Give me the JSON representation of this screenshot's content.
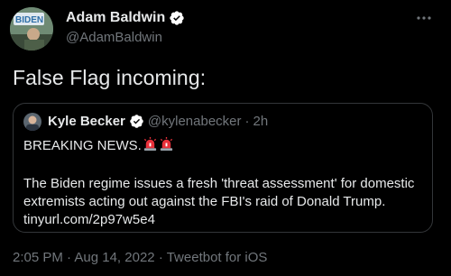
{
  "tweet": {
    "author_name": "Adam Baldwin",
    "author_handle": "@AdamBaldwin",
    "avatar_text": "BIDEN",
    "text": "False Flag incoming:",
    "meta": {
      "time": "2:05 PM",
      "date": "Aug 14, 2022",
      "client": "Tweetbot for iOS",
      "separator": "·"
    }
  },
  "quoted_tweet": {
    "author_name": "Kyle Becker",
    "author_handle": "@kylenabecker",
    "separator": "·",
    "time": "2h",
    "line1": "BREAKING NEWS.",
    "line2": "The Biden regime issues a fresh 'threat assessment' for domestic",
    "line3": "extremists acting out against the FBI's raid of Donald Trump.",
    "link": "tinyurl.com/2p97w5e4"
  },
  "icons": [
    "verified-badge-icon",
    "more-options-icon",
    "siren-emoji-icon"
  ],
  "colors": {
    "background": "#000000",
    "text_primary": "#e7e9ea",
    "text_secondary": "#71767b",
    "border": "#333639",
    "verified": "#ffffff"
  }
}
